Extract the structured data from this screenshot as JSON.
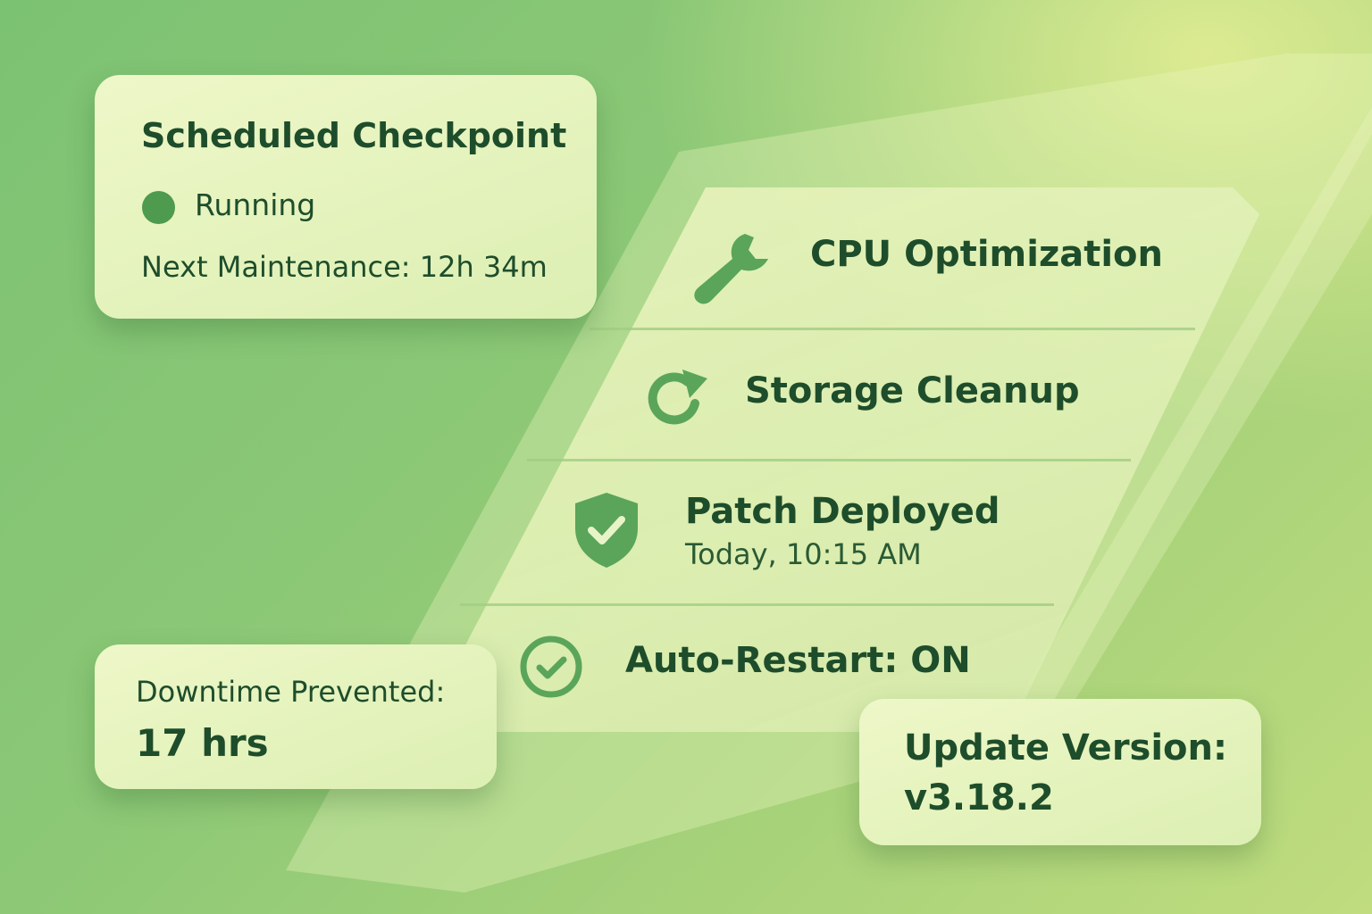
{
  "checkpoint": {
    "title": "Scheduled Checkpoint",
    "status": "Running",
    "status_color": "#4e9a4f",
    "next_maintenance": "Next Maintenance: 12h 34m"
  },
  "tasks": [
    {
      "label": "CPU Optimization",
      "icon": "wrench-icon"
    },
    {
      "label": "Storage Cleanup",
      "icon": "refresh-icon"
    },
    {
      "label": "Patch Deployed",
      "sub": "Today, 10:15 AM",
      "icon": "shield-check-icon"
    },
    {
      "label": "Auto-Restart: ON",
      "icon": "check-circle-icon"
    }
  ],
  "downtime": {
    "label": "Downtime Prevented:",
    "value": "17 hrs"
  },
  "update": {
    "label": "Update Version:",
    "value": "v3.18.2"
  },
  "colors": {
    "accent": "#4e9a4f",
    "text": "#1e4d2b"
  }
}
